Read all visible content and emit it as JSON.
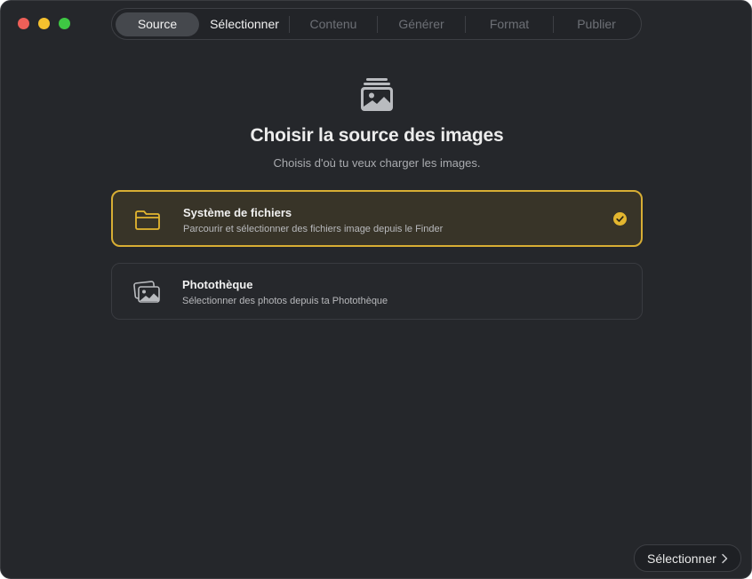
{
  "window": {
    "controls": [
      "close",
      "minimize",
      "maximize"
    ]
  },
  "steps": [
    {
      "label": "Source",
      "state": "active"
    },
    {
      "label": "Sélectionner",
      "state": "enabled"
    },
    {
      "label": "Contenu",
      "state": "disabled"
    },
    {
      "label": "Générer",
      "state": "disabled"
    },
    {
      "label": "Format",
      "state": "disabled"
    },
    {
      "label": "Publier",
      "state": "disabled"
    }
  ],
  "header": {
    "icon": "photo-stack-icon",
    "title": "Choisir la source des images",
    "subtitle": "Choisis d'où tu veux charger les images."
  },
  "sources": [
    {
      "icon": "folder-icon",
      "title": "Système de fichiers",
      "description": "Parcourir et sélectionner des fichiers image depuis le Finder",
      "selected": true
    },
    {
      "icon": "photos-library-icon",
      "title": "Photothèque",
      "description": "Sélectionner des photos depuis ta Photothèque",
      "selected": false
    }
  ],
  "footer": {
    "next_label": "Sélectionner"
  },
  "colors": {
    "accent": "#e3b62f",
    "background": "#25272b"
  }
}
